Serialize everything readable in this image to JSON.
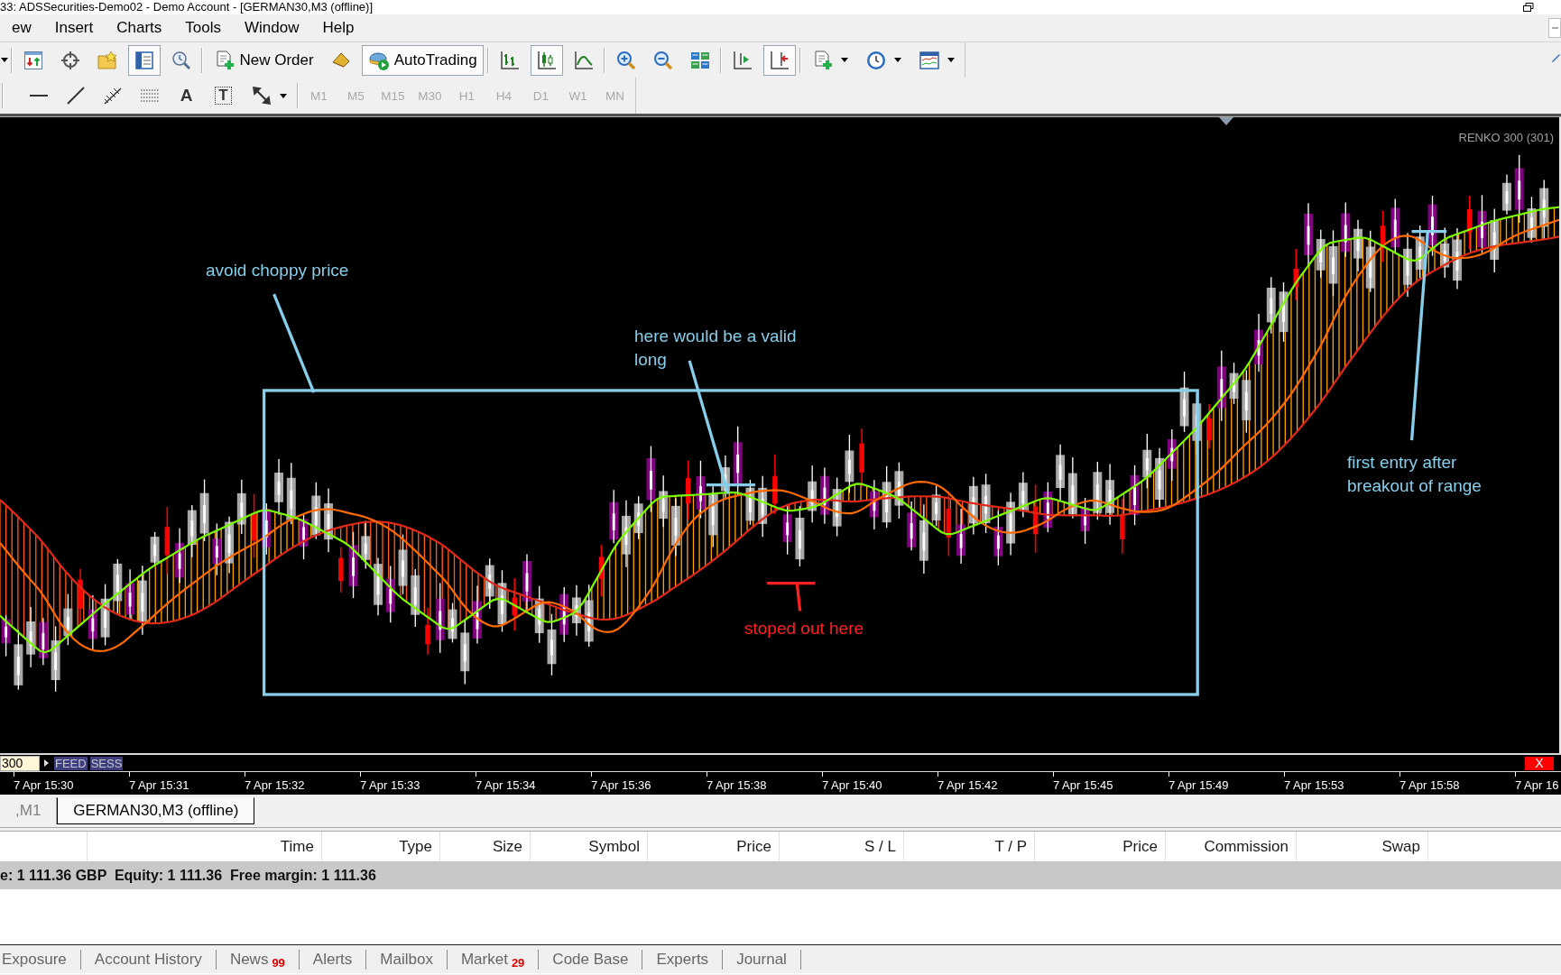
{
  "window": {
    "title": "33: ADSSecurities-Demo02 - Demo Account - [GERMAN30,M3 (offline)]"
  },
  "menu": [
    "ew",
    "Insert",
    "Charts",
    "Tools",
    "Window",
    "Help"
  ],
  "toolbar_1": [
    {
      "items": [
        {
          "kind": "caret"
        }
      ]
    },
    {
      "items": [
        {
          "kind": "icon",
          "pressed": false
        },
        {
          "kind": "icon",
          "pressed": false
        },
        {
          "kind": "icon",
          "pressed": false
        },
        {
          "kind": "icon",
          "pressed": true
        },
        {
          "kind": "icon",
          "pressed": false
        }
      ]
    },
    {
      "items": [
        {
          "kind": "labeled",
          "label": "New Order",
          "pressed": false
        },
        {
          "kind": "icon",
          "pressed": false
        },
        {
          "kind": "labeled",
          "label": "AutoTrading",
          "pressed": true
        }
      ]
    },
    {
      "items": [
        {
          "kind": "icon",
          "pressed": false
        },
        {
          "kind": "icon",
          "pressed": true
        },
        {
          "kind": "icon",
          "pressed": false
        }
      ]
    },
    {
      "items": [
        {
          "kind": "icon",
          "pressed": false
        },
        {
          "kind": "icon",
          "pressed": false
        },
        {
          "kind": "icon",
          "pressed": false
        }
      ]
    },
    {
      "items": [
        {
          "kind": "icon",
          "pressed": false
        },
        {
          "kind": "icon",
          "pressed": true
        }
      ]
    },
    {
      "items": [
        {
          "kind": "menu",
          "pressed": false
        },
        {
          "kind": "menu",
          "pressed": false
        },
        {
          "kind": "menu",
          "pressed": false
        }
      ]
    }
  ],
  "toolbar_2": {
    "tools": [
      {
        "kind": "icon"
      },
      {
        "kind": "icon"
      },
      {
        "kind": "icon"
      },
      {
        "kind": "icon"
      },
      {
        "kind": "letter",
        "label": "A"
      },
      {
        "kind": "boxed-letter",
        "label": "T"
      },
      {
        "kind": "menu"
      }
    ],
    "timeframes": [
      {
        "label": "M1",
        "disabled": true
      },
      {
        "label": "M5",
        "disabled": true
      },
      {
        "label": "M15",
        "disabled": true
      },
      {
        "label": "M30",
        "disabled": true
      },
      {
        "label": "H1",
        "disabled": true
      },
      {
        "label": "H4",
        "disabled": true
      },
      {
        "label": "D1",
        "disabled": true
      },
      {
        "label": "W1",
        "disabled": true
      },
      {
        "label": "MN",
        "disabled": true
      }
    ]
  },
  "chart": {
    "indicator_label": "RENKO 300 (301)",
    "annotations": [
      {
        "text": "avoid choppy price",
        "color": "#87ceeb"
      },
      {
        "text": "here would be a valid long",
        "color": "#87ceeb"
      },
      {
        "text": "stoped out here",
        "color": "#ff2020"
      },
      {
        "text": "first entry after breakout of range",
        "color": "#87ceeb"
      }
    ],
    "strip": {
      "value": "300",
      "labels": [
        "FEED",
        "SESS"
      ],
      "close": "X"
    },
    "time_axis": [
      "7 Apr 15:30",
      "7 Apr 15:31",
      "7 Apr 15:32",
      "7 Apr 15:33",
      "7 Apr 15:34",
      "7 Apr 15:36",
      "7 Apr 15:38",
      "7 Apr 15:40",
      "7 Apr 15:42",
      "7 Apr 15:45",
      "7 Apr 15:49",
      "7 Apr 15:53",
      "7 Apr 15:58",
      "7 Apr 16"
    ]
  },
  "chart_tabs": [
    {
      "label": ",M1",
      "selected": false
    },
    {
      "label": "GERMAN30,M3 (offline)",
      "selected": true
    }
  ],
  "terminal": {
    "columns": [
      "Time",
      "Type",
      "Size",
      "Symbol",
      "Price",
      "S / L",
      "T / P",
      "Price",
      "Commission",
      "Swap"
    ],
    "summary": "e: 1 111.36 GBP  Equity: 1 111.36  Free margin: 1 111.36",
    "tabs": [
      {
        "label": "Exposure",
        "selected": false
      },
      {
        "label": "Account History",
        "selected": false
      },
      {
        "label": "News",
        "badge": "99",
        "selected": false
      },
      {
        "label": "Alerts",
        "selected": false
      },
      {
        "label": "Mailbox",
        "selected": false
      },
      {
        "label": "Market",
        "badge": "29",
        "selected": false
      },
      {
        "label": "Code Base",
        "selected": false
      },
      {
        "label": "Experts",
        "selected": false
      },
      {
        "label": "Journal",
        "selected": false
      }
    ]
  }
}
